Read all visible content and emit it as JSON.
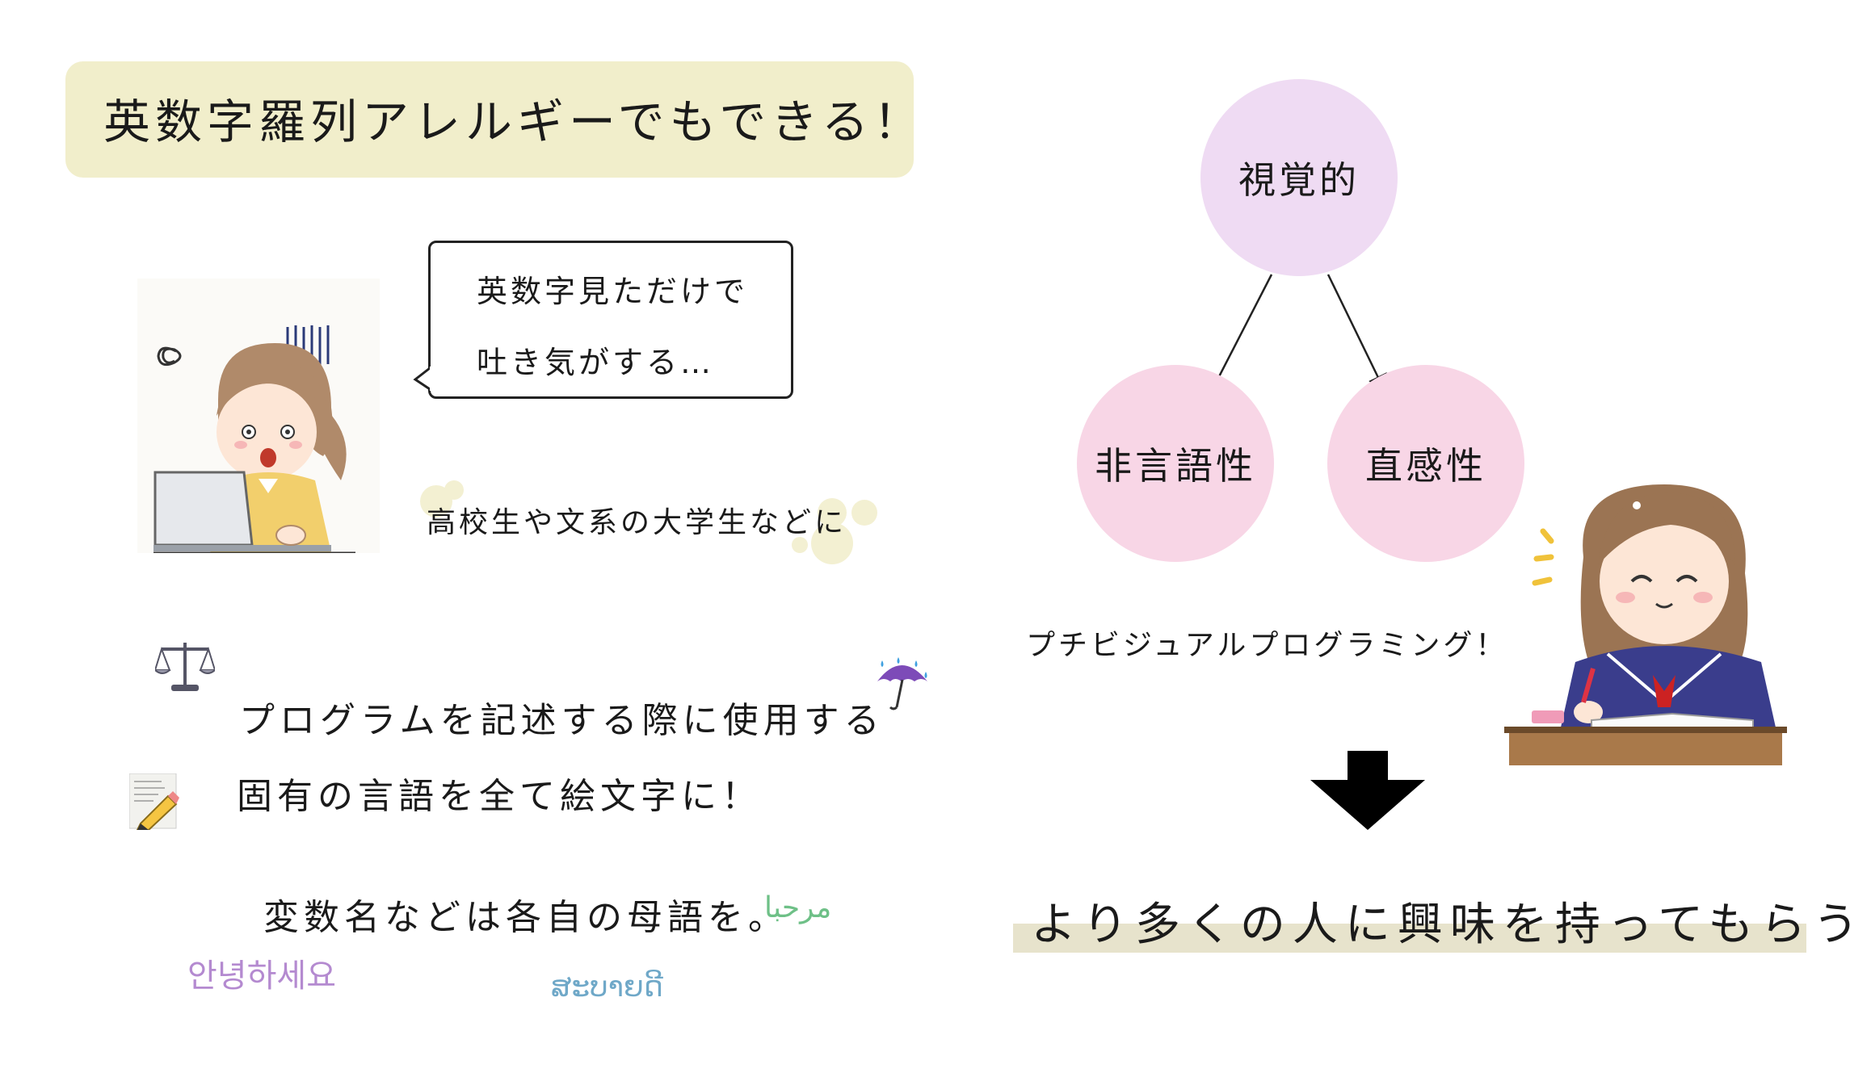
{
  "title": "英数字羅列アレルギーでもできる！",
  "bubble": {
    "line1": "英数字見ただけで",
    "line2": "吐き気がする…"
  },
  "caption_students": "高校生や文系の大学生などに",
  "main": {
    "line_program": "プログラムを記述する際に使用する",
    "line_emoji": "固有の言語を全て絵文字に！",
    "line_variables": "変数名などは各自の母語を。"
  },
  "greetings": {
    "korean": "안녕하세요",
    "arabic": "مرحبا",
    "lao": "ສະບາຍດີ"
  },
  "diagram": {
    "top": "視覚的",
    "left": "非言語性",
    "right": "直感性"
  },
  "caption_petit": "プチビジュアルプログラミング！",
  "conclusion": "より多くの人に興味を持ってもらう",
  "icons": [
    "balance-scale-icon",
    "umbrella-rain-icon",
    "memo-pencil-icon",
    "down-arrow-icon"
  ],
  "colors": {
    "title_bg": "#f1eecb",
    "circle_top": "#efdbf3",
    "circle_bottom": "#f8d6e6",
    "highlight": "#e7e3cc",
    "korean": "#b48ad0",
    "arabic": "#6ec087",
    "lao": "#6fa8c8"
  }
}
